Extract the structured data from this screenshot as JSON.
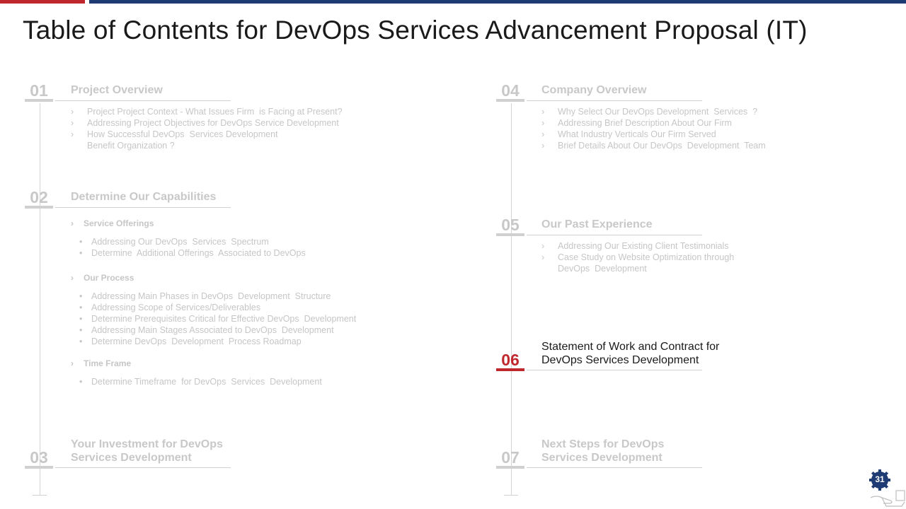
{
  "header": {
    "title": "Table of Contents for DevOps Services Advancement Proposal (IT)"
  },
  "sections": [
    {
      "number": "01",
      "title": "Project Overview",
      "items": [
        {
          "mark": "›",
          "text": "Project Project Context - What Issues Firm  is Facing at Present?"
        },
        {
          "mark": "›",
          "text": "Addressing Project Objectives for DevOps Service Development"
        },
        {
          "mark": "›",
          "text": "How Successful DevOps  Services Development\nBenefit Organization ?"
        }
      ]
    },
    {
      "number": "02",
      "title": "Determine Our Capabilities",
      "groups": [
        {
          "label": "Service Offerings",
          "items": [
            "Addressing Our DevOps  Services  Spectrum",
            "Determine  Additional Offerings  Associated to DevOps"
          ]
        },
        {
          "label": "Our Process",
          "items": [
            "Addressing Main Phases in DevOps  Development  Structure",
            "Addressing Scope of Services/Deliverables",
            "Determine Prerequisites Critical for Effective DevOps  Development",
            "Addressing Main Stages Associated to DevOps  Development",
            "Determine DevOps  Development  Process Roadmap"
          ]
        },
        {
          "label": "Time Frame",
          "items": [
            "Determine Timeframe  for DevOps  Services  Development"
          ]
        }
      ]
    },
    {
      "number": "03",
      "title_line1": "Your Investment for DevOps",
      "title_line2": "Services Development"
    },
    {
      "number": "04",
      "title": "Company Overview",
      "items": [
        {
          "mark": "›",
          "text": "Why Select Our DevOps Development  Services  ?"
        },
        {
          "mark": "›",
          "text": "Addressing Brief Description About Our Firm"
        },
        {
          "mark": "›",
          "text": "What Industry Verticals Our Firm Served"
        },
        {
          "mark": "›",
          "text": "Brief Details About Our DevOps  Development  Team"
        }
      ]
    },
    {
      "number": "05",
      "title": "Our Past Experience",
      "items": [
        {
          "mark": "›",
          "text": "Addressing Our Existing Client Testimonials"
        },
        {
          "mark": "›",
          "text": "Case Study on Website Optimization through\nDevOps  Development"
        }
      ]
    },
    {
      "number": "06",
      "title_line1": "Statement of Work and Contract for",
      "title_line2": "DevOps Services Development",
      "active": true
    },
    {
      "number": "07",
      "title_line1": "Next Steps for DevOps",
      "title_line2": "Services Development"
    }
  ],
  "marks": {
    "chevron": "›",
    "bullet": "•"
  },
  "footer": {
    "page_number": "31"
  },
  "colors": {
    "accent_red": "#c0272d",
    "accent_blue": "#1f3b73",
    "muted": "#c8c8c8"
  }
}
